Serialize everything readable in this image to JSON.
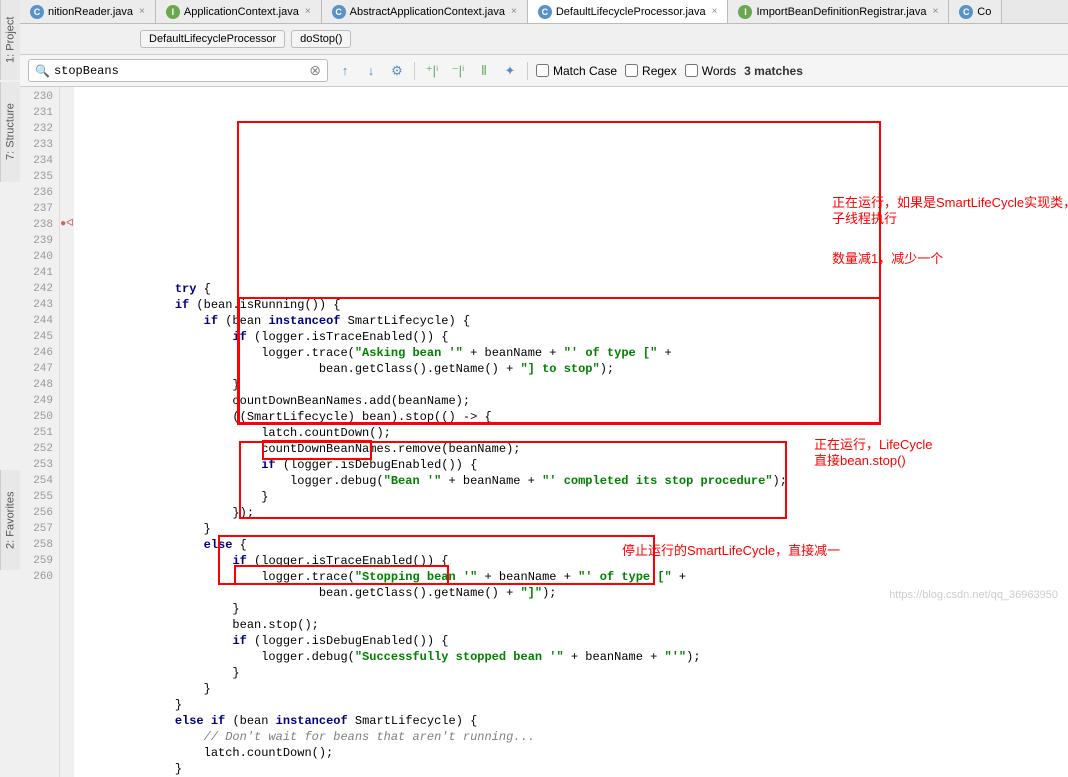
{
  "tabs": [
    {
      "label": "nitionReader.java",
      "active": false,
      "closable": true
    },
    {
      "label": "ApplicationContext.java",
      "active": false,
      "closable": true
    },
    {
      "label": "AbstractApplicationContext.java",
      "active": false,
      "closable": true
    },
    {
      "label": "DefaultLifecycleProcessor.java",
      "active": true,
      "closable": true
    },
    {
      "label": "ImportBeanDefinitionRegistrar.java",
      "active": false,
      "closable": true
    },
    {
      "label": "Co",
      "active": false,
      "closable": false
    }
  ],
  "breadcrumb": {
    "class": "DefaultLifecycleProcessor",
    "method": "doStop()"
  },
  "search": {
    "value": "stopBeans",
    "match_case": "Match Case",
    "regex": "Regex",
    "words": "Words",
    "matches": "3 matches"
  },
  "gutter": {
    "start": 230,
    "end": 260,
    "marked": 238,
    "mark_symbol": "●ᐊ"
  },
  "code_lines": [
    "              try {",
    "              if (bean.isRunning()) {",
    "                  if (bean instanceof SmartLifecycle) {",
    "                      if (logger.isTraceEnabled()) {",
    "                          logger.trace(\"Asking bean '\" + beanName + \"' of type [\" +",
    "                                  bean.getClass().getName() + \"] to stop\");",
    "                      }",
    "                      countDownBeanNames.add(beanName);",
    "                      ((SmartLifecycle) bean).stop(() -> {",
    "                          latch.countDown();",
    "                          countDownBeanNames.remove(beanName);",
    "                          if (logger.isDebugEnabled()) {",
    "                              logger.debug(\"Bean '\" + beanName + \"' completed its stop procedure\");",
    "                          }",
    "                      });",
    "                  }",
    "                  else {",
    "                      if (logger.isTraceEnabled()) {",
    "                          logger.trace(\"Stopping bean '\" + beanName + \"' of type [\" +",
    "                                  bean.getClass().getName() + \"]\");",
    "                      }",
    "                      bean.stop();",
    "                      if (logger.isDebugEnabled()) {",
    "                          logger.debug(\"Successfully stopped bean '\" + beanName + \"'\");",
    "                      }",
    "                  }",
    "              }",
    "              else if (bean instanceof SmartLifecycle) {",
    "                  // Don't wait for beans that aren't running...",
    "                  latch.countDown();",
    "              }"
  ],
  "annotations": {
    "a1_l1": "正在运行，如果是SmartLifeCycle实现类，",
    "a1_l2": "子线程执行",
    "a2": "数量减1，减少一个",
    "a3_l1": "正在运行，LifeCycle",
    "a3_l2": "直接bean.stop()",
    "a4": "停止运行的SmartLifeCycle，直接减一"
  },
  "sidetabs": {
    "project": "1: Project",
    "structure": "7: Structure",
    "favorites": "2: Favorites"
  },
  "watermark": "https://blog.csdn.net/qq_36963950"
}
